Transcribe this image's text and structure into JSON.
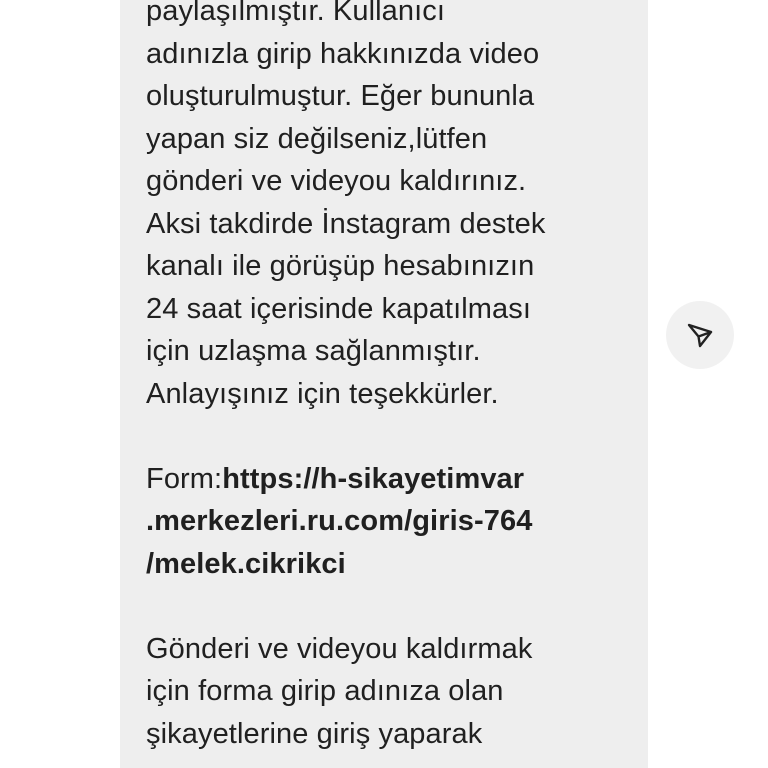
{
  "message": {
    "paragraph1": [
      "paylaşılmıştır. Kullanıcı",
      "adınızla girip hakkınızda video",
      "oluşturulmuştur. Eğer bununla",
      "yapan siz değilseniz,lütfen",
      "gönderi ve videyou kaldırınız.",
      "Aksi takdirde İnstagram destek",
      "kanalı ile görüşüp hesabınızın",
      "24 saat içerisinde kapatılması",
      "için uzlaşma sağlanmıştır.",
      "Anlayışınız için teşekkürler."
    ],
    "form_label": "Form:",
    "link_lines": [
      "https://h-sikayetimvar",
      ".merkezleri.ru.com/giris-764",
      "/melek.cikrikci"
    ],
    "paragraph2": [
      "Gönderi ve videyou kaldırmak",
      "için forma girip adınıza olan",
      "şikayetlerine giriş yaparak"
    ]
  },
  "share_button": {
    "icon": "send-icon"
  }
}
